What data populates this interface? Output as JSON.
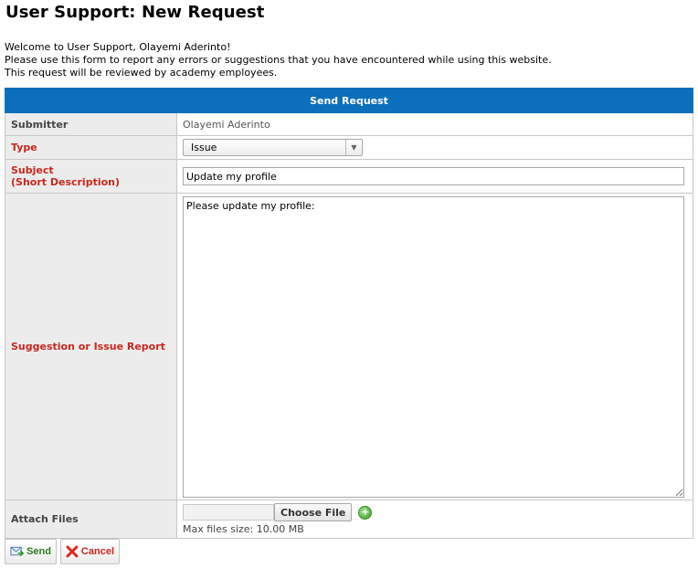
{
  "page": {
    "title": "User Support: New Request"
  },
  "intro": {
    "line1": "Welcome to User Support, Olayemi Aderinto!",
    "line2": "Please use this form to report any errors or suggestions that you have encountered while using this website.",
    "line3": "This request will be reviewed by academy employees."
  },
  "form": {
    "header": "Send Request",
    "submitter": {
      "label": "Submitter",
      "value": "Olayemi Aderinto"
    },
    "type": {
      "label": "Type",
      "selected": "Issue"
    },
    "subject": {
      "label_line1": "Subject",
      "label_line2": "(Short Description)",
      "value": "Update my profile"
    },
    "report": {
      "label": "Suggestion or Issue Report",
      "value": "Please update my profile:"
    },
    "attach": {
      "label": "Attach Files",
      "choose_label": "Choose File",
      "max_size": "Max files size: 10.00 MB"
    }
  },
  "actions": {
    "send_label": "Send",
    "cancel_label": "Cancel"
  },
  "colors": {
    "header_bg": "#0b6fbb",
    "required_label": "#c8281e",
    "send_text": "#2a7a20"
  }
}
